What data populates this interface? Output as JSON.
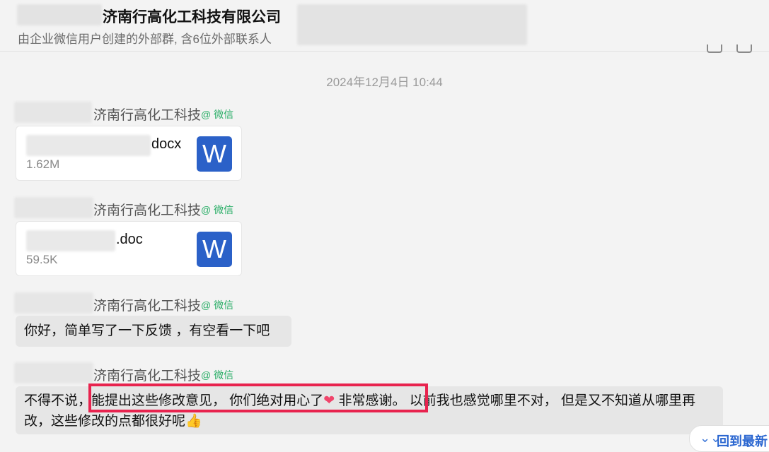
{
  "header": {
    "title": "济南行高化工科技有限公司",
    "subtitle": "由企业微信用户创建的外部群, 含6位外部联系人"
  },
  "timestamp": "2024年12月4日 10:44",
  "messages": [
    {
      "org": "济南行高化工科技",
      "tag": "@ 微信",
      "file_name": "docx",
      "file_size": "1.62M",
      "icon_letter": "W"
    },
    {
      "org": "济南行高化工科技",
      "tag": "@ 微信",
      "file_name": ".doc",
      "file_size": "59.5K",
      "icon_letter": "W"
    },
    {
      "org": "济南行高化工科技",
      "tag": "@ 微信",
      "text": "你好，简单写了一下反馈 ，有空看一下吧"
    },
    {
      "org": "济南行高化工科技",
      "tag": "@ 微信",
      "text_part1": "不得不说，",
      "text_part2": "能提出这些修改意见， 你们绝对用心了",
      "heart": "❤",
      "text_part3": " 非常感谢。",
      "text_part4": " 以前我也感觉哪里不对， 但是又不知道从哪里再改，这些修改的点都很好呢",
      "thumb": "👍"
    }
  ],
  "back_to_latest": {
    "chevron": "⌄⌄",
    "label": "回到最新"
  },
  "colors": {
    "accent_blue": "#2b61c8",
    "wechat_green": "#2aae67",
    "highlight_red": "#e8234e"
  }
}
